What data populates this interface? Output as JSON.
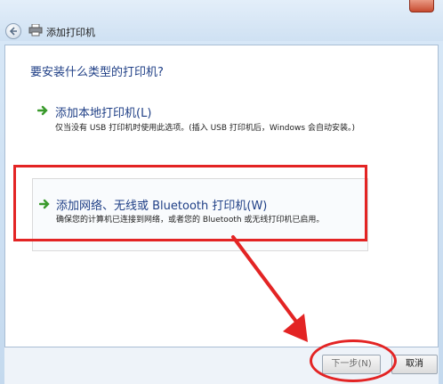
{
  "window": {
    "title": "添加打印机"
  },
  "main": {
    "question": "要安装什么类型的打印机?",
    "options": [
      {
        "title": "添加本地打印机(L)",
        "description": "仅当没有 USB 打印机时使用此选项。(插入 USB 打印机后，Windows 会自动安装。)"
      },
      {
        "title": "添加网络、无线或 Bluetooth 打印机(W)",
        "description": "确保您的计算机已连接到网络，或者您的 Bluetooth 或无线打印机已启用。"
      }
    ]
  },
  "footer": {
    "next_label": "下一步(N)",
    "cancel_label": "取消"
  },
  "colors": {
    "accent_text": "#1f3f86",
    "annotation_red": "#e32424",
    "arrow_green": "#3a9a2c"
  },
  "icons": {
    "back": "back-arrow-icon",
    "printer": "printer-icon",
    "option_arrow": "green-arrow-icon"
  }
}
